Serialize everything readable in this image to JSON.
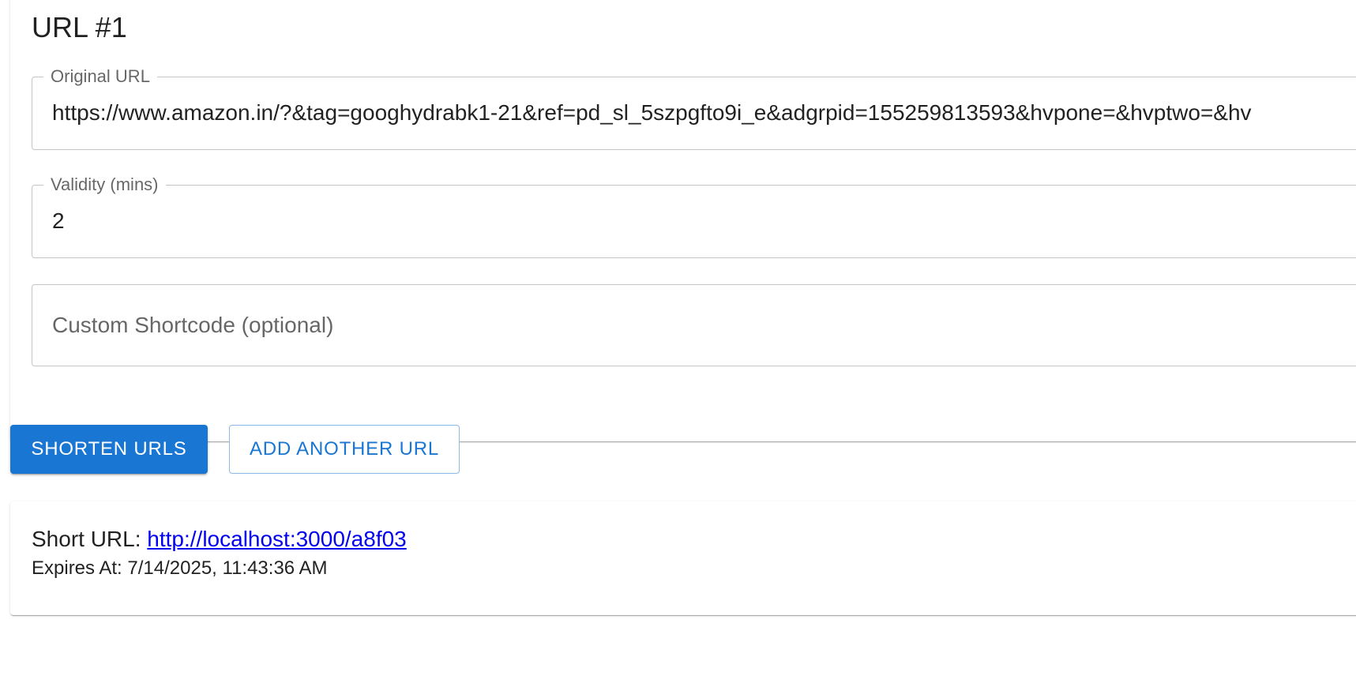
{
  "form": {
    "heading": "URL #1",
    "original_url": {
      "label": "Original URL",
      "value": "https://www.amazon.in/?&tag=googhydrabk1-21&ref=pd_sl_5szpgfto9i_e&adgrpid=155259813593&hvpone=&hvptwo=&hv"
    },
    "validity": {
      "label": "Validity (mins)",
      "value": "2"
    },
    "shortcode": {
      "placeholder": "Custom Shortcode (optional)",
      "value": ""
    }
  },
  "actions": {
    "shorten_label": "SHORTEN URLS",
    "add_label": "ADD ANOTHER URL",
    "primary_color": "#1976d2"
  },
  "result": {
    "short_url_label": "Short URL:",
    "short_url": "http://localhost:3000/a8f03",
    "expires_label": "Expires At:",
    "expires_at": "7/14/2025, 11:43:36 AM"
  }
}
